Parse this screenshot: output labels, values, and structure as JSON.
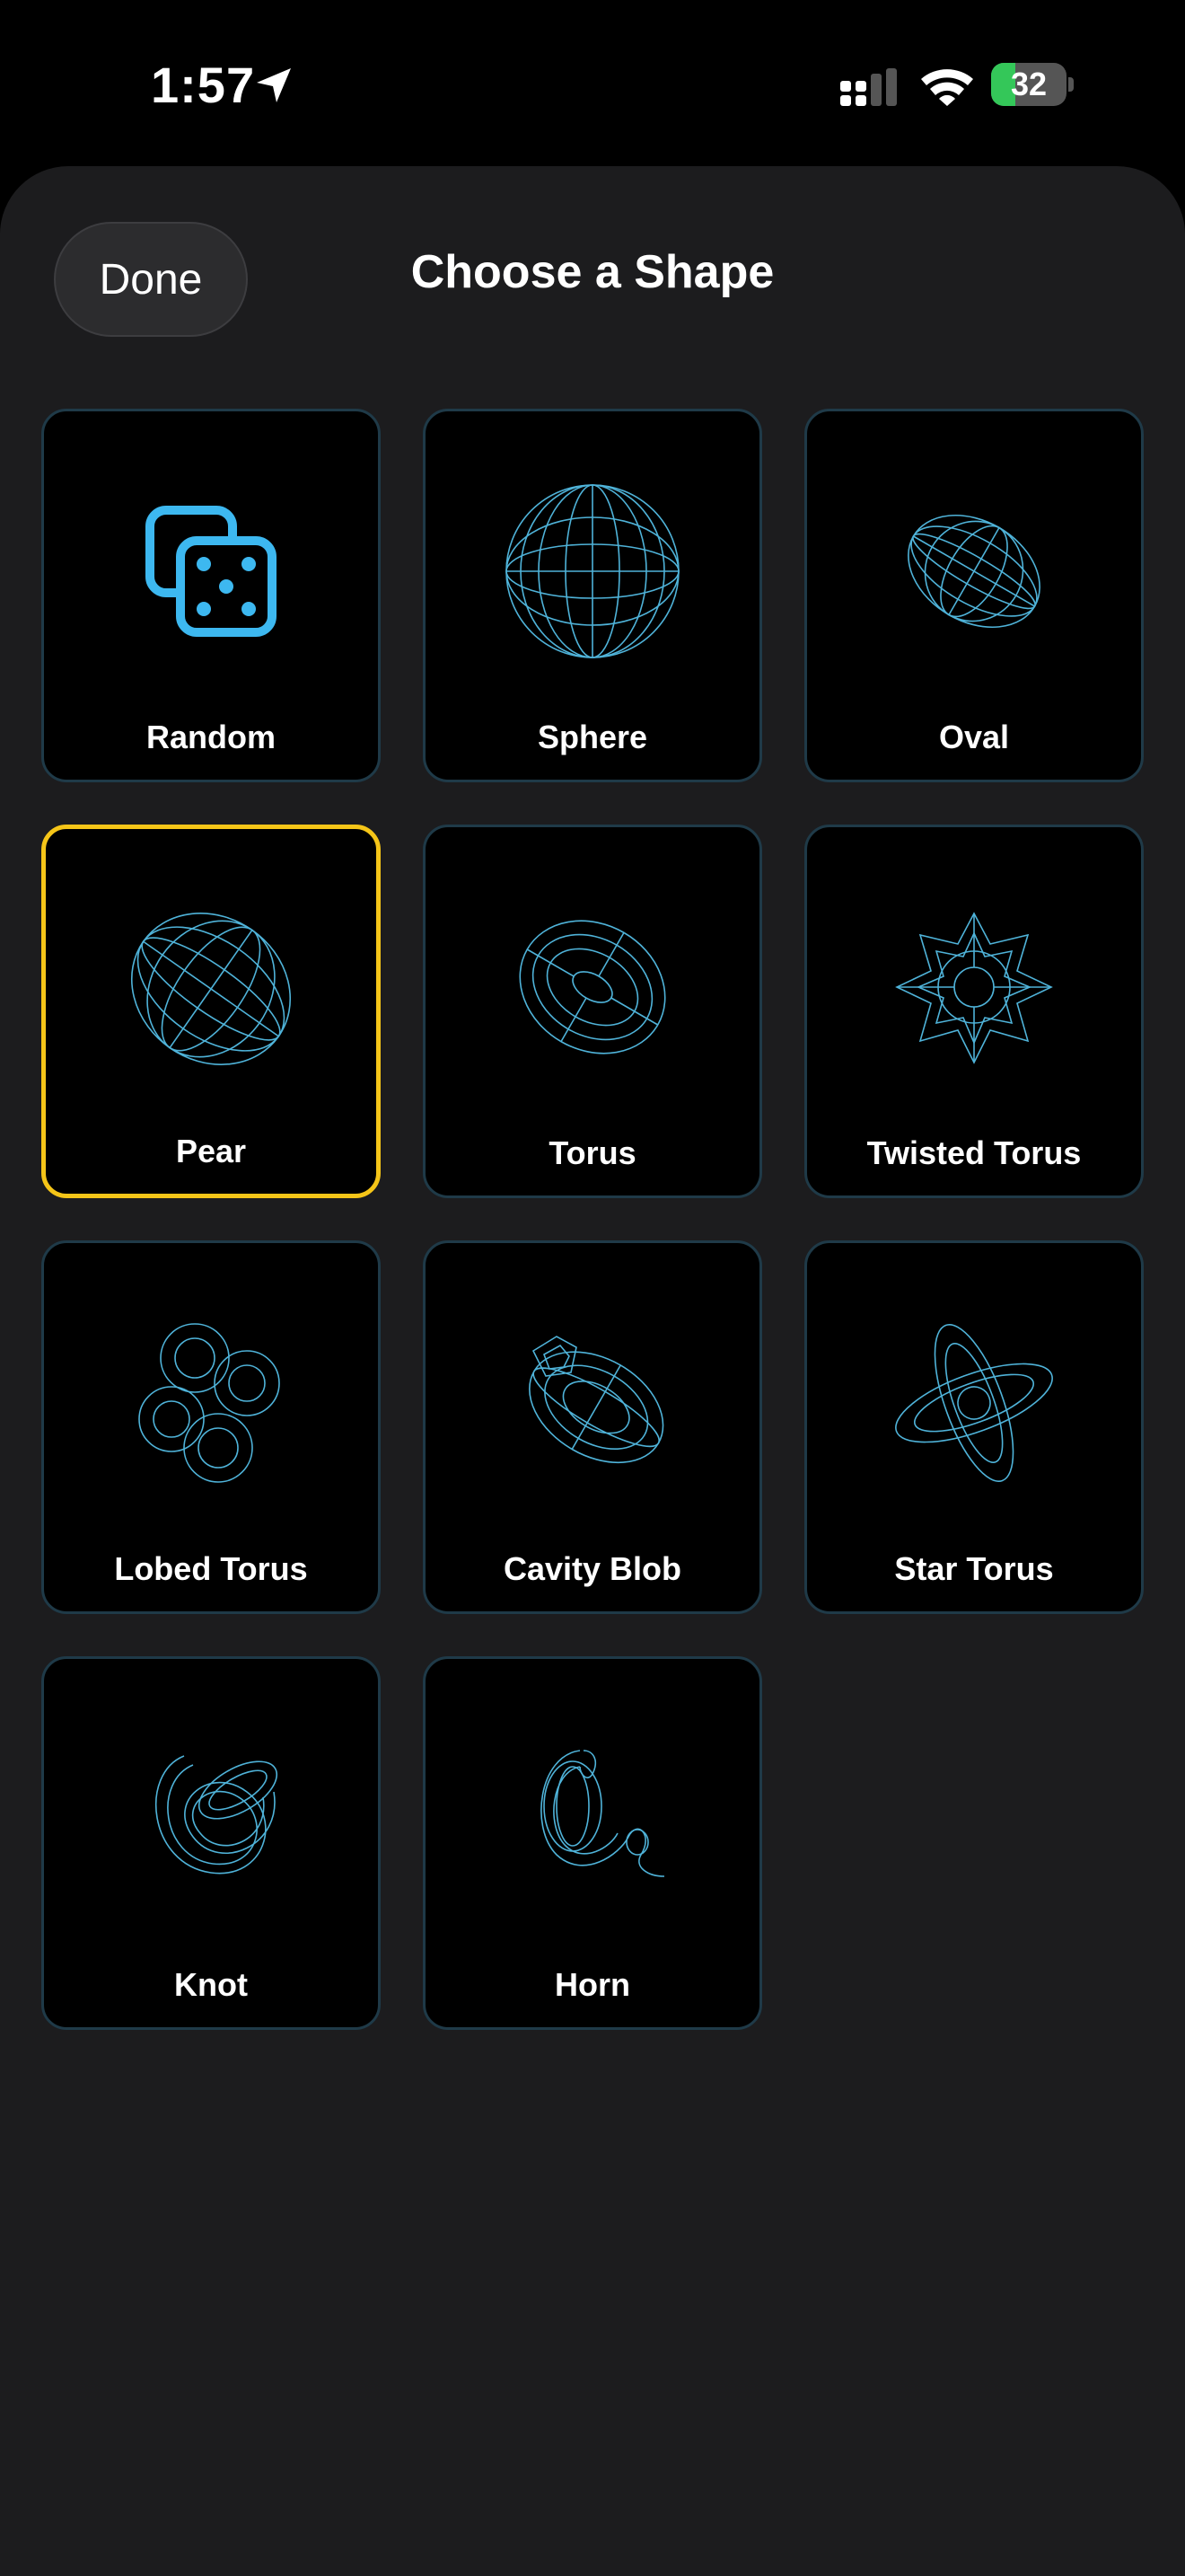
{
  "status_bar": {
    "time": "1:57",
    "battery_level": "32",
    "battery_fraction": 0.32,
    "battery_color": "#34c759",
    "icons": [
      "location-arrow-icon",
      "signal-icon",
      "wifi-icon",
      "battery-icon"
    ]
  },
  "sheet": {
    "done_label": "Done",
    "title": "Choose a Shape"
  },
  "shapes": [
    {
      "label": "Random",
      "icon": "dice-icon",
      "selected": false
    },
    {
      "label": "Sphere",
      "icon": "sphere-wireframe-icon",
      "selected": false
    },
    {
      "label": "Oval",
      "icon": "oval-wireframe-icon",
      "selected": false
    },
    {
      "label": "Pear",
      "icon": "pear-wireframe-icon",
      "selected": true
    },
    {
      "label": "Torus",
      "icon": "torus-wireframe-icon",
      "selected": false
    },
    {
      "label": "Twisted Torus",
      "icon": "twisted-torus-wireframe-icon",
      "selected": false
    },
    {
      "label": "Lobed Torus",
      "icon": "lobed-torus-wireframe-icon",
      "selected": false
    },
    {
      "label": "Cavity Blob",
      "icon": "cavity-blob-wireframe-icon",
      "selected": false
    },
    {
      "label": "Star Torus",
      "icon": "star-torus-wireframe-icon",
      "selected": false
    },
    {
      "label": "Knot",
      "icon": "knot-wireframe-icon",
      "selected": false
    },
    {
      "label": "Horn",
      "icon": "horn-wireframe-icon",
      "selected": false
    }
  ],
  "colors": {
    "accent_wire": "#4fb3d9",
    "dice": "#3db8f0",
    "selected_border": "#f5c518",
    "tile_border": "#1f3a48",
    "sheet_bg": "#1c1c1e"
  }
}
